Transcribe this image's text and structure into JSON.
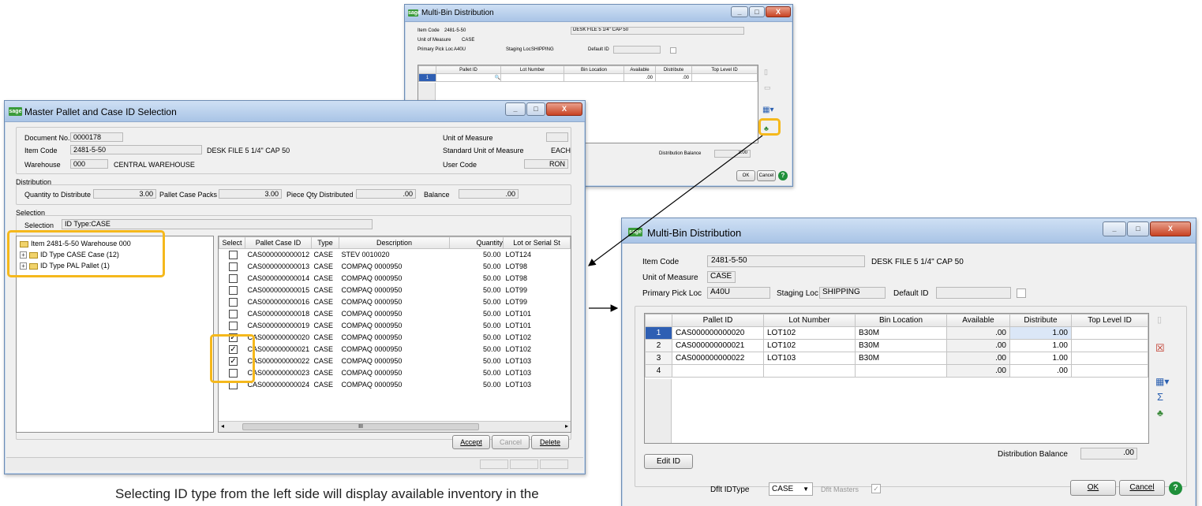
{
  "caption": "Selecting ID type from the left side will display available inventory in the",
  "small": {
    "title": "Multi-Bin Distribution",
    "item_code_label": "Item Code",
    "item_code": "2481-5-50",
    "desc": "DESK FILE 5 1/4\" CAP 50",
    "uom_label": "Unit of Measure",
    "uom": "CASE",
    "ppl_label": "Primary Pick Loc",
    "ppl": "A40U",
    "staging_label": "Staging Loc",
    "staging": "SHIPPING",
    "default_id_label": "Default ID",
    "columns": [
      "Pallet ID",
      "Lot Number",
      "Bin Location",
      "Available",
      "Distribute",
      "Top Level ID"
    ],
    "row": {
      "num": "1",
      "available": ".00",
      "distribute": ".00"
    },
    "balance_label": "Distribution Balance",
    "balance": "3.00",
    "ok": "OK",
    "cancel": "Cancel"
  },
  "master": {
    "title": "Master Pallet and Case ID Selection",
    "doc_label": "Document No.",
    "doc": "0000178",
    "item_label": "Item Code",
    "item": "2481-5-50",
    "item_desc": "DESK FILE 5 1/4\" CAP 50",
    "wh_label": "Warehouse",
    "wh": "000",
    "wh_desc": "CENTRAL WAREHOUSE",
    "uom_label": "Unit of Measure",
    "std_uom_label": "Standard Unit of Measure",
    "std_uom": "EACH",
    "user_label": "User Code",
    "user": "RON",
    "dist_label": "Distribution",
    "qty_label": "Quantity to Distribute",
    "qty": "3.00",
    "pcp_label": "Pallet Case Packs",
    "pcp": "3.00",
    "pqd_label": "Piece Qty Distributed",
    "pqd": ".00",
    "bal_label": "Balance",
    "bal": ".00",
    "sel_group": "Selection",
    "sel_label": "Selection",
    "sel_value": "ID Type:CASE",
    "tree": [
      "Item 2481-5-50 Warehouse 000",
      "ID Type CASE Case (12)",
      "ID Type PAL  Pallet (1)"
    ],
    "columns": [
      "Select",
      "Pallet Case ID",
      "Type",
      "Description",
      "Quantity",
      "Lot or Serial St"
    ],
    "rows": [
      {
        "checked": false,
        "id": "CAS000000000012",
        "type": "CASE",
        "desc": "STEV 0010020",
        "qty": "50.00",
        "lot": "LOT124"
      },
      {
        "checked": false,
        "id": "CAS000000000013",
        "type": "CASE",
        "desc": "COMPAQ 0000950",
        "qty": "50.00",
        "lot": "LOT98"
      },
      {
        "checked": false,
        "id": "CAS000000000014",
        "type": "CASE",
        "desc": "COMPAQ 0000950",
        "qty": "50.00",
        "lot": "LOT98"
      },
      {
        "checked": false,
        "id": "CAS000000000015",
        "type": "CASE",
        "desc": "COMPAQ 0000950",
        "qty": "50.00",
        "lot": "LOT99"
      },
      {
        "checked": false,
        "id": "CAS000000000016",
        "type": "CASE",
        "desc": "COMPAQ 0000950",
        "qty": "50.00",
        "lot": "LOT99"
      },
      {
        "checked": false,
        "id": "CAS000000000018",
        "type": "CASE",
        "desc": "COMPAQ 0000950",
        "qty": "50.00",
        "lot": "LOT101"
      },
      {
        "checked": false,
        "id": "CAS000000000019",
        "type": "CASE",
        "desc": "COMPAQ 0000950",
        "qty": "50.00",
        "lot": "LOT101"
      },
      {
        "checked": true,
        "id": "CAS000000000020",
        "type": "CASE",
        "desc": "COMPAQ 0000950",
        "qty": "50.00",
        "lot": "LOT102"
      },
      {
        "checked": true,
        "id": "CAS000000000021",
        "type": "CASE",
        "desc": "COMPAQ 0000950",
        "qty": "50.00",
        "lot": "LOT102"
      },
      {
        "checked": true,
        "id": "CAS000000000022",
        "type": "CASE",
        "desc": "COMPAQ 0000950",
        "qty": "50.00",
        "lot": "LOT103"
      },
      {
        "checked": false,
        "id": "CAS000000000023",
        "type": "CASE",
        "desc": "COMPAQ 0000950",
        "qty": "50.00",
        "lot": "LOT103"
      },
      {
        "checked": false,
        "id": "CAS000000000024",
        "type": "CASE",
        "desc": "COMPAQ 0000950",
        "qty": "50.00",
        "lot": "LOT103"
      }
    ],
    "accept": "Accept",
    "cancel": "Cancel",
    "delete": "Delete"
  },
  "big": {
    "title": "Multi-Bin Distribution",
    "item_code_label": "Item Code",
    "item_code": "2481-5-50",
    "desc": "DESK FILE 5 1/4\" CAP 50",
    "uom_label": "Unit of Measure",
    "uom": "CASE",
    "ppl_label": "Primary Pick Loc",
    "ppl": "A40U",
    "staging_label": "Staging Loc",
    "staging": "SHIPPING",
    "default_id_label": "Default ID",
    "columns": [
      "Pallet ID",
      "Lot Number",
      "Bin Location",
      "Available",
      "Distribute",
      "Top Level ID"
    ],
    "rows": [
      {
        "num": "1",
        "pallet": "CAS000000000020",
        "lot": "LOT102",
        "bin": "B30M",
        "available": ".00",
        "distribute": "1.00",
        "top": ""
      },
      {
        "num": "2",
        "pallet": "CAS000000000021",
        "lot": "LOT102",
        "bin": "B30M",
        "available": ".00",
        "distribute": "1.00",
        "top": ""
      },
      {
        "num": "3",
        "pallet": "CAS000000000022",
        "lot": "LOT103",
        "bin": "B30M",
        "available": ".00",
        "distribute": "1.00",
        "top": ""
      },
      {
        "num": "4",
        "pallet": "",
        "lot": "",
        "bin": "",
        "available": ".00",
        "distribute": ".00",
        "top": ""
      }
    ],
    "balance_label": "Distribution Balance",
    "balance": ".00",
    "edit_id": "Edit ID",
    "dflt_type_label": "Dflt IDType",
    "dflt_type": "CASE",
    "dflt_masters_label": "Dflt Masters",
    "ok": "OK",
    "cancel": "Cancel"
  },
  "colors": {
    "highlight": "#f5b81c",
    "title_gradient": "#b9d1ee",
    "close": "#c84323",
    "sage": "#3a9b3a"
  }
}
